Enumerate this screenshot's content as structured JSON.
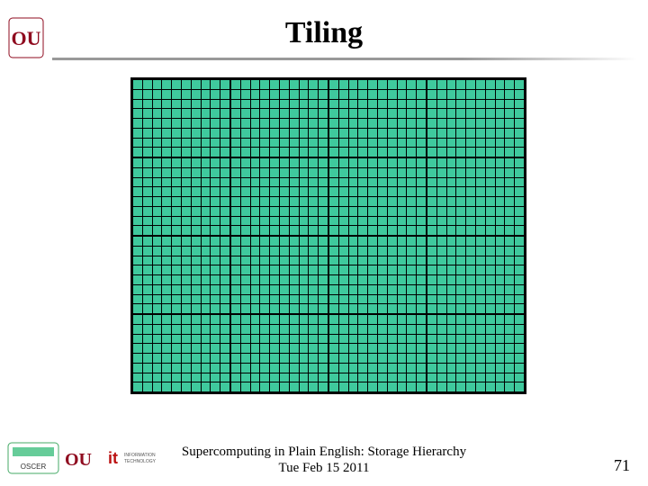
{
  "title": "Tiling",
  "grid": {
    "major_rows": 4,
    "major_cols": 4,
    "minor_rows": 8,
    "minor_cols": 10,
    "cell_color": "#3fc99d"
  },
  "footer": {
    "line1": "Supercomputing in Plain English: Storage Hierarchy",
    "line2": "Tue Feb 15 2011"
  },
  "page_number": "71",
  "logos": {
    "ou_main": "OU",
    "oscer": "OSCER",
    "ou_small": "OU",
    "it": "INFORMATION TECHNOLOGY"
  }
}
